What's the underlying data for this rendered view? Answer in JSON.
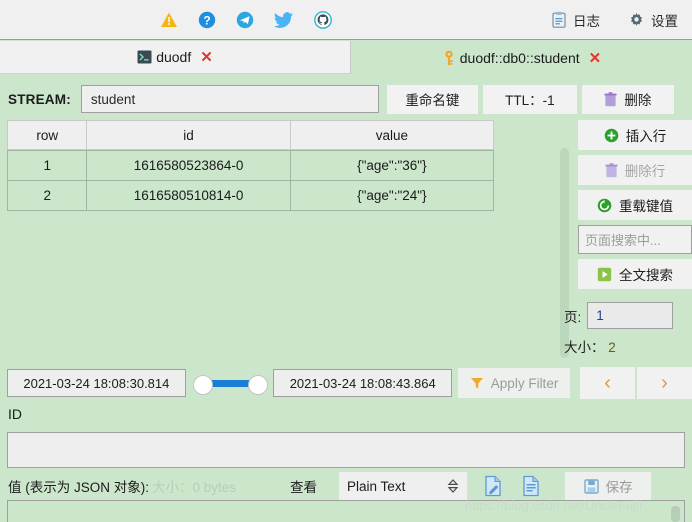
{
  "toolbar": {
    "icons": [
      {
        "name": "warning-icon",
        "label": "warning"
      },
      {
        "name": "help-icon",
        "label": "help"
      },
      {
        "name": "telegram-icon",
        "label": "telegram"
      },
      {
        "name": "twitter-icon",
        "label": "twitter"
      },
      {
        "name": "github-icon",
        "label": "github"
      }
    ],
    "log_label": "日志",
    "settings_label": "设置"
  },
  "tabs": [
    {
      "label": "duodf",
      "icon": "console-icon",
      "close": "✕",
      "active": false
    },
    {
      "label": "duodf::db0::student",
      "icon": "key-icon",
      "close": "✕",
      "active": true
    }
  ],
  "stream": {
    "label": "STREAM:",
    "key_value": "student",
    "rename_label": "重命名键",
    "ttl_label": "TTL：-1",
    "delete_label": "删除"
  },
  "table": {
    "headers": [
      "row",
      "id",
      "value"
    ],
    "rows": [
      [
        "1",
        "1616580523864-0",
        "{\"age\":\"36\"}"
      ],
      [
        "2",
        "1616580510814-0",
        "{\"age\":\"24\"}"
      ]
    ]
  },
  "side": {
    "insert_row_label": "插入行",
    "delete_row_label": "删除行",
    "reload_label": "重载键值",
    "search_placeholder": "页面搜索中...",
    "fulltext_label": "全文搜索",
    "page_label": "页:",
    "page_value": "1",
    "size_label": "大小：",
    "size_value": "2"
  },
  "filter": {
    "date_from": "2021-03-24 18:08:30.814",
    "date_to": "2021-03-24 18:08:43.864",
    "apply_label": "Apply Filter",
    "prev_label": "‹",
    "next_label": "›"
  },
  "id_section": {
    "label": "ID",
    "value": ""
  },
  "value_section": {
    "label": "值 (表示为 JSON 对象):",
    "size_text": "大小：0 bytes",
    "view_label": "查看",
    "format_selected": "Plain Text",
    "save_label": "保存",
    "value": ""
  },
  "watermark": "https://blog.csdn.net/UncleFujii",
  "colors": {
    "background": "#cbe6cb",
    "panel": "#f1f1f1",
    "accent_blue": "#1a7fd4",
    "accent_green": "#29a329",
    "accent_red": "#e8342a",
    "accent_orange": "#f2a62c",
    "disabled": "#9b9b9b"
  }
}
